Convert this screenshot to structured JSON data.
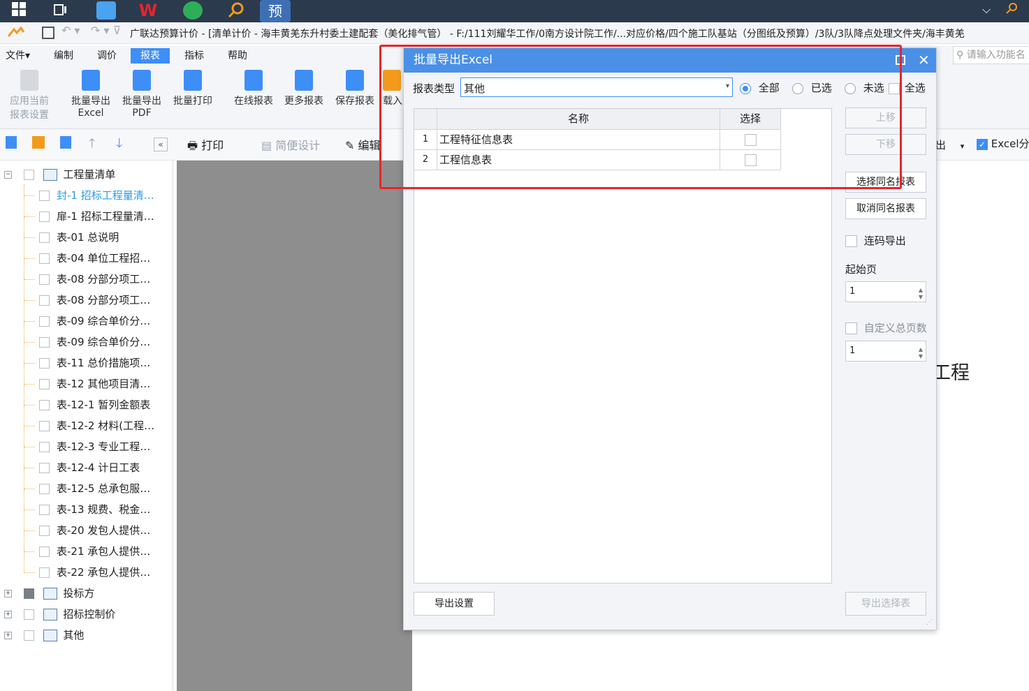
{
  "window": {
    "app_title": "广联达预算计价 - [清单计价 - 海丰黄羌东升村委土建配套（美化排气管） - F:/111刘耀华工作/0南方设计院工作/...对应价格/四个施工队基站（分图纸及预算）/3队/3队降点处理文件夹/海丰黄羌"
  },
  "taskbar": {
    "app_badge": "预"
  },
  "menu": {
    "items": [
      "文件▾",
      "编制",
      "调价",
      "报表",
      "指标",
      "帮助"
    ],
    "active": "报表",
    "search_placeholder": "请输入功能名"
  },
  "ribbon": {
    "buttons": [
      {
        "line1": "应用当前",
        "line2": "报表设置"
      },
      {
        "line1": "批量导出",
        "line2": "Excel"
      },
      {
        "line1": "批量导出",
        "line2": "PDF"
      },
      {
        "line1": "批量打印",
        "line2": ""
      },
      {
        "line1": "在线报表",
        "line2": ""
      },
      {
        "line1": "更多报表",
        "line2": ""
      },
      {
        "line1": "保存报表",
        "line2": ""
      },
      {
        "line1": "载入",
        "line2": ""
      }
    ]
  },
  "toolbar2": {
    "print": "打印",
    "simple_design": "简便设计",
    "edit": "编辑",
    "export_tail": "出",
    "excel_check": "Excel分"
  },
  "tree": {
    "root": "工程量清单",
    "items": [
      "封-1 招标工程量清…",
      "扉-1 招标工程量清…",
      "表-01 总说明",
      "表-04 单位工程招…",
      "表-08 分部分项工…",
      "表-08 分部分项工…",
      "表-09 综合单价分…",
      "表-09 综合单价分…",
      "表-11 总价措施项…",
      "表-12 其他项目清…",
      "表-12-1 暂列金额表",
      "表-12-2 材料(工程…",
      "表-12-3 专业工程…",
      "表-12-4 计日工表",
      "表-12-5 总承包服…",
      "表-13 规费、税金…",
      "表-20 发包人提供…",
      "表-21 承包人提供…",
      "表-22 承包人提供…"
    ],
    "groups": [
      "投标方",
      "招标控制价",
      "其他"
    ]
  },
  "doc": {
    "partial_text": "工程"
  },
  "dialog": {
    "title": "批量导出Excel",
    "report_type_label": "报表类型",
    "report_type_value": "其他",
    "filters": [
      "全部",
      "已选",
      "未选"
    ],
    "filter_selected": "全部",
    "select_all": "全选",
    "columns": [
      "名称",
      "选择"
    ],
    "rows": [
      {
        "index": "1",
        "name": "工程特征信息表",
        "checked": false
      },
      {
        "index": "2",
        "name": "工程信息表",
        "checked": false
      }
    ],
    "buttons": {
      "move_up": "上移",
      "move_down": "下移",
      "select_same": "选择同名报表",
      "cancel_same": "取消同名报表",
      "export_settings": "导出设置",
      "export_selected": "导出选择表"
    },
    "continuous_export": "连码导出",
    "start_page_label": "起始页",
    "start_page_value": "1",
    "custom_total_label": "自定义总页数",
    "custom_total_value": "1"
  },
  "colors": {
    "accent": "#3e8ef7",
    "dialog_title_bg": "#4a90e6",
    "highlight_box": "#e8242a",
    "tree_link": "#2e9be0"
  }
}
